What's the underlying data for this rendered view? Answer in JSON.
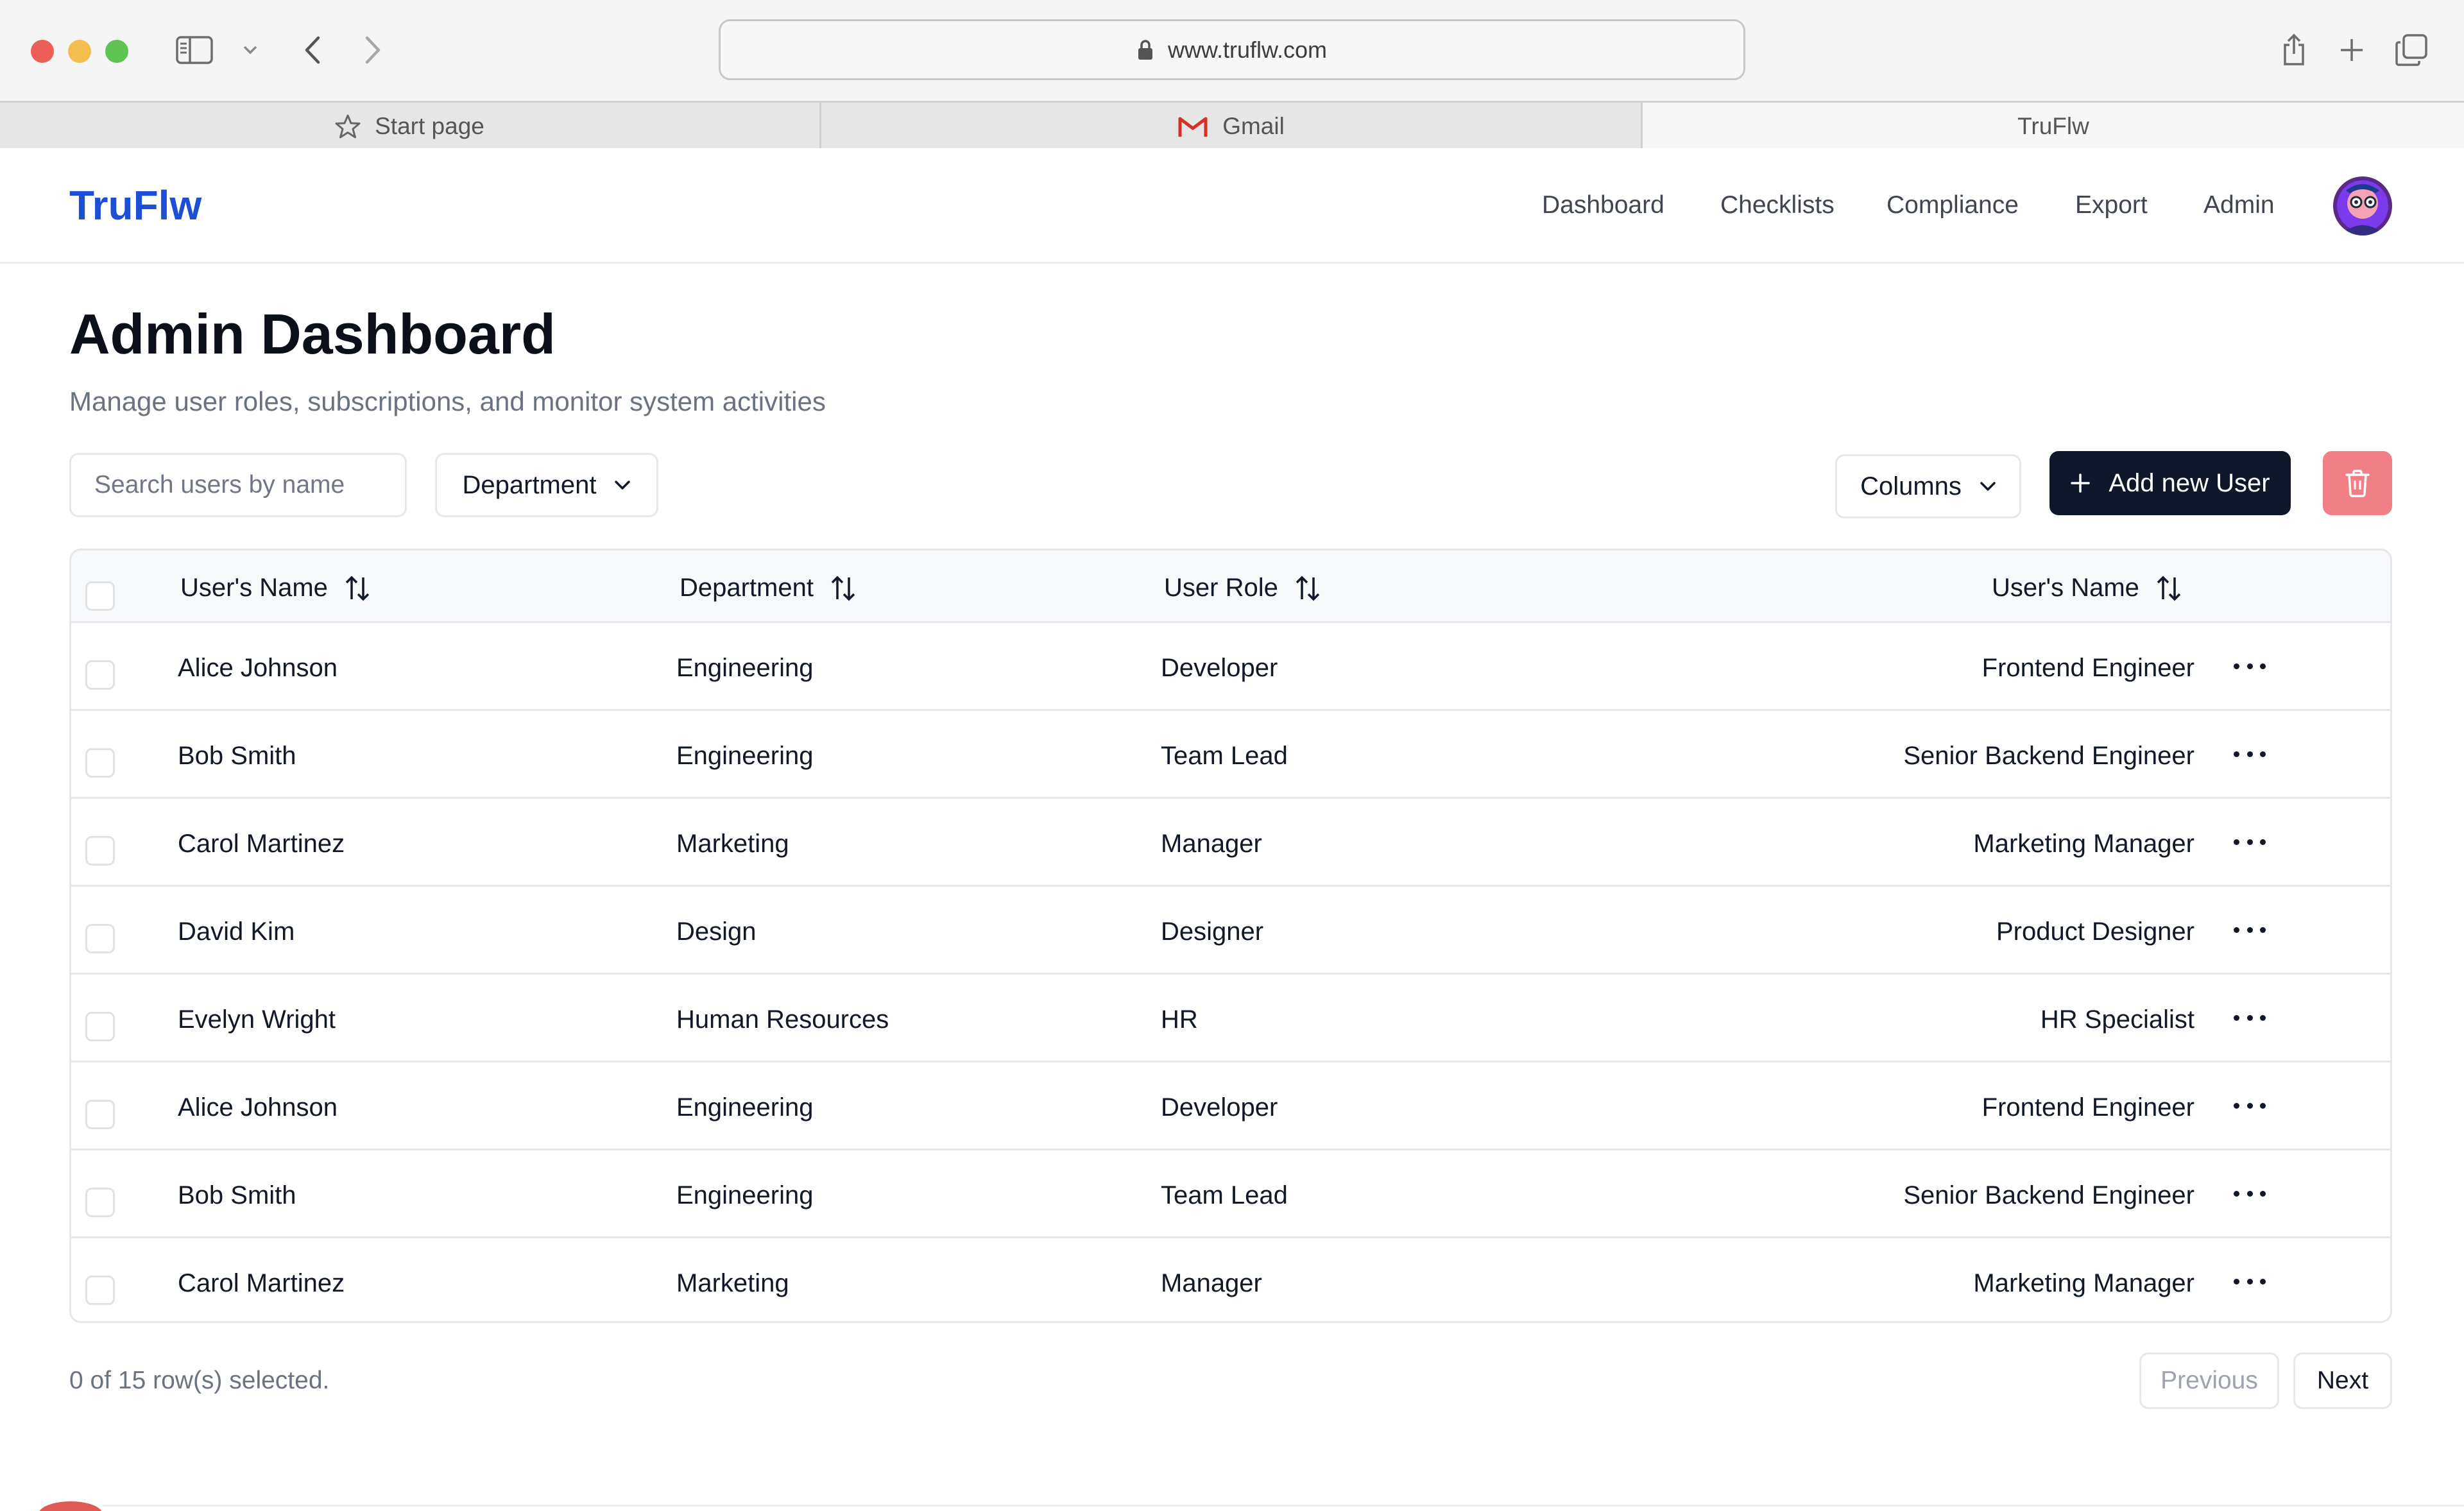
{
  "browser": {
    "url": "www.truflw.com",
    "tabs": [
      {
        "label": "Start page",
        "icon": "star-icon"
      },
      {
        "label": "Gmail",
        "icon": "gmail-icon"
      },
      {
        "label": "TruFlw",
        "icon": ""
      }
    ]
  },
  "header": {
    "brand": "TruFlw",
    "nav": [
      "Dashboard",
      "Checklists",
      "Compliance",
      "Export",
      "Admin"
    ]
  },
  "page": {
    "title": "Admin Dashboard",
    "subtitle": "Manage user roles, subscriptions, and monitor system activities"
  },
  "toolbar": {
    "search_placeholder": "Search users by name",
    "department_filter": "Department",
    "columns_button": "Columns",
    "add_user_button": "Add new User"
  },
  "table": {
    "headers": [
      "User's Name",
      "Department",
      "User Role",
      "User's Name"
    ],
    "rows": [
      {
        "name": "Alice Johnson",
        "department": "Engineering",
        "role": "Developer",
        "title": "Frontend Engineer"
      },
      {
        "name": "Bob Smith",
        "department": "Engineering",
        "role": "Team Lead",
        "title": "Senior Backend Engineer"
      },
      {
        "name": "Carol Martinez",
        "department": "Marketing",
        "role": "Manager",
        "title": "Marketing Manager"
      },
      {
        "name": "David Kim",
        "department": "Design",
        "role": "Designer",
        "title": "Product Designer"
      },
      {
        "name": "Evelyn Wright",
        "department": "Human Resources",
        "role": "HR",
        "title": "HR Specialist"
      },
      {
        "name": "Alice Johnson",
        "department": "Engineering",
        "role": "Developer",
        "title": "Frontend Engineer"
      },
      {
        "name": "Bob Smith",
        "department": "Engineering",
        "role": "Team Lead",
        "title": "Senior Backend Engineer"
      },
      {
        "name": "Carol Martinez",
        "department": "Marketing",
        "role": "Manager",
        "title": "Marketing Manager"
      }
    ]
  },
  "footer": {
    "selection_text": "0 of 15 row(s) selected.",
    "previous": "Previous",
    "next": "Next"
  },
  "colors": {
    "brand": "#1d4ed8",
    "primary_button": "#0f172a",
    "danger_button": "#f07f86"
  }
}
